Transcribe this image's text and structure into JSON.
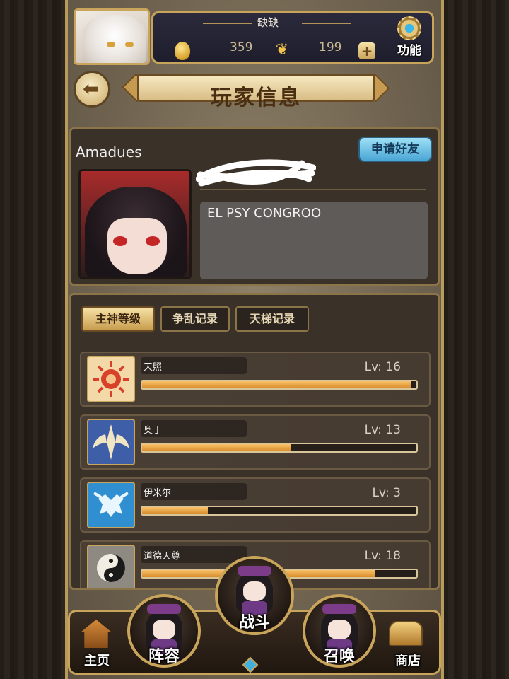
{
  "header": {
    "player_name": "缺缺",
    "resource_a": "359",
    "resource_b": "199",
    "function_label": "功能",
    "icons": [
      "coin-icon",
      "butterfly-icon",
      "plus-icon",
      "gear-icon",
      "back-arrow-icon"
    ]
  },
  "page": {
    "title": "玩家信息"
  },
  "profile": {
    "name": "Amadues",
    "add_friend_label": "申请好友",
    "signature": "EL PSY CONGROO"
  },
  "tabs": [
    {
      "label": "主神等级",
      "active": true
    },
    {
      "label": "争乱记录",
      "active": false
    },
    {
      "label": "天梯记录",
      "active": false
    }
  ],
  "gods": [
    {
      "name": "天照",
      "level": "Lv: 16",
      "progress": 0.98,
      "icon": "sun-emblem-icon",
      "color": "#f3d9a8"
    },
    {
      "name": "奥丁",
      "level": "Lv: 13",
      "progress": 0.54,
      "icon": "winged-spear-icon",
      "color": "#3f5ea8"
    },
    {
      "name": "伊米尔",
      "level": "Lv: 3",
      "progress": 0.24,
      "icon": "ice-giant-icon",
      "color": "#2f8fd0"
    },
    {
      "name": "道德天尊",
      "level": "Lv: 18",
      "progress": 0.85,
      "icon": "yin-yang-icon",
      "color": "#8e8a82"
    }
  ],
  "nav": {
    "home": "主页",
    "lineup": "阵容",
    "battle": "战斗",
    "summon": "召唤",
    "shop": "商店"
  },
  "colors": {
    "gold_border": "#c9a45b",
    "panel": "#3a3129",
    "bar_fill": "#e89c3a",
    "friend_button": "#5fb8e2"
  }
}
